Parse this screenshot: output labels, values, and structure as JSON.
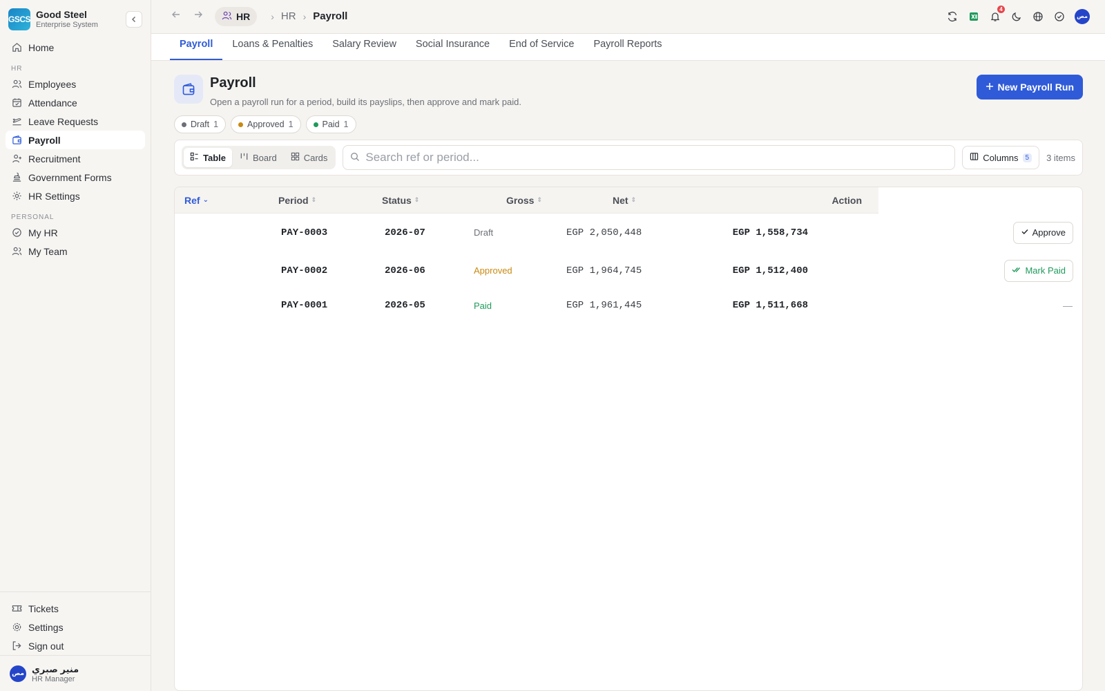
{
  "brand": {
    "logo": "GSCS",
    "name": "Good Steel",
    "subtitle": "Enterprise System"
  },
  "sidebar": {
    "home": "Home",
    "section_hr": "HR",
    "hr_items": [
      "Employees",
      "Attendance",
      "Leave Requests",
      "Payroll",
      "Recruitment",
      "Government Forms",
      "HR Settings"
    ],
    "section_personal": "PERSONAL",
    "personal_items": [
      "My HR",
      "My Team"
    ],
    "bottom_items": [
      "Tickets",
      "Settings",
      "Sign out"
    ],
    "active": "Payroll"
  },
  "user": {
    "avatar": "مص",
    "name": "منير صبري",
    "role": "HR Manager"
  },
  "topbar": {
    "module_chip": "HR",
    "breadcrumb": [
      "HR",
      "Payroll"
    ],
    "notifications_count": "4",
    "avatar": "مص"
  },
  "tabs": [
    "Payroll",
    "Loans & Penalties",
    "Salary Review",
    "Social Insurance",
    "End of Service",
    "Payroll Reports"
  ],
  "page": {
    "title": "Payroll",
    "description": "Open a payroll run for a period, build its payslips, then approve and mark paid.",
    "primary_action": "New Payroll Run"
  },
  "status_pills": [
    {
      "label": "Draft",
      "count": "1",
      "color": "#6b6f76"
    },
    {
      "label": "Approved",
      "count": "1",
      "color": "#c98a12"
    },
    {
      "label": "Paid",
      "count": "1",
      "color": "#1f9a5b"
    }
  ],
  "toolbar": {
    "views": [
      "Table",
      "Board",
      "Cards"
    ],
    "active_view": "Table",
    "search_placeholder": "Search ref or period...",
    "columns_label": "Columns",
    "columns_count": "5",
    "items_count": "3 items"
  },
  "table": {
    "headers": {
      "ref": "Ref",
      "period": "Period",
      "status": "Status",
      "gross": "Gross",
      "net": "Net",
      "action": "Action"
    },
    "rows": [
      {
        "ref": "PAY-0003",
        "period": "2026-07",
        "status": "Draft",
        "status_color": "#6b6f76",
        "gross": "EGP 2,050,448",
        "net": "EGP 1,558,734",
        "action": "Approve",
        "action_color": "#1f2328"
      },
      {
        "ref": "PAY-0002",
        "period": "2026-06",
        "status": "Approved",
        "status_color": "#c98a12",
        "gross": "EGP 1,964,745",
        "net": "EGP 1,512,400",
        "action": "Mark Paid",
        "action_color": "#1f9a5b"
      },
      {
        "ref": "PAY-0001",
        "period": "2026-05",
        "status": "Paid",
        "status_color": "#1f9a5b",
        "gross": "EGP 1,961,445",
        "net": "EGP 1,511,668",
        "action": "—",
        "action_color": "#9a9ea5"
      }
    ]
  },
  "colors": {
    "accent": "#2f5bd8",
    "sidebar_bg": "#f7f5f2",
    "page_bg": "#f6f4f1"
  }
}
